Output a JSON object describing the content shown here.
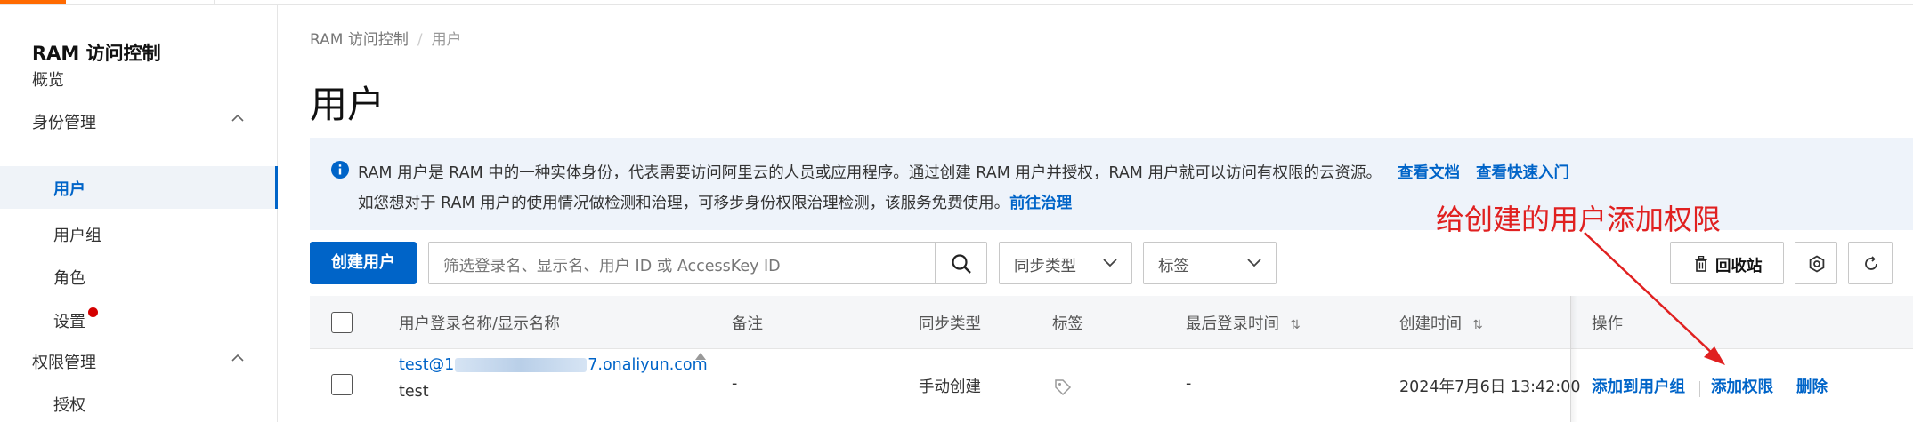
{
  "colors": {
    "primary": "#0064c8",
    "accent": "#ff6a00",
    "annotation": "#e02020",
    "notice_bg": "#eef3fa"
  },
  "sidebar": {
    "title": "RAM 访问控制",
    "overview": "概览",
    "identity_group": "身份管理",
    "users": "用户",
    "user_groups": "用户组",
    "roles": "角色",
    "settings": "设置",
    "permission_group": "权限管理",
    "grants": "授权"
  },
  "breadcrumb": {
    "root": "RAM 访问控制",
    "separator": "/",
    "current": "用户"
  },
  "page": {
    "title": "用户"
  },
  "notice": {
    "line1": "RAM 用户是 RAM 中的一种实体身份，代表需要访问阿里云的人员或应用程序。通过创建 RAM 用户并授权，RAM 用户就可以访问有权限的云资源。",
    "link_docs": "查看文档",
    "link_quickstart": "查看快速入门",
    "line2": "如您想对于 RAM 用户的使用情况做检测和治理，可移步身份权限治理检测，该服务免费使用。",
    "link_govern": "前往治理"
  },
  "annotation": {
    "text": "给创建的用户添加权限"
  },
  "toolbar": {
    "create_user": "创建用户",
    "search_placeholder": "筛选登录名、显示名、用户 ID 或 AccessKey ID",
    "sync_type": "同步类型",
    "tags": "标签",
    "recycle": "回收站"
  },
  "table": {
    "headers": {
      "login_name": "用户登录名称/显示名称",
      "remark": "备注",
      "sync_type": "同步类型",
      "tags": "标签",
      "last_login": "最后登录时间",
      "created": "创建时间",
      "ops": "操作"
    },
    "rows": [
      {
        "login_prefix": "test@1",
        "login_suffix": "7.onaliyun.com",
        "display_name": "test",
        "remark": "-",
        "sync_type": "手动创建",
        "last_login": "-",
        "created": "2024年7月6日 13:42:00",
        "op_add_group": "添加到用户组",
        "op_add_permission": "添加权限",
        "op_delete": "删除"
      }
    ]
  }
}
